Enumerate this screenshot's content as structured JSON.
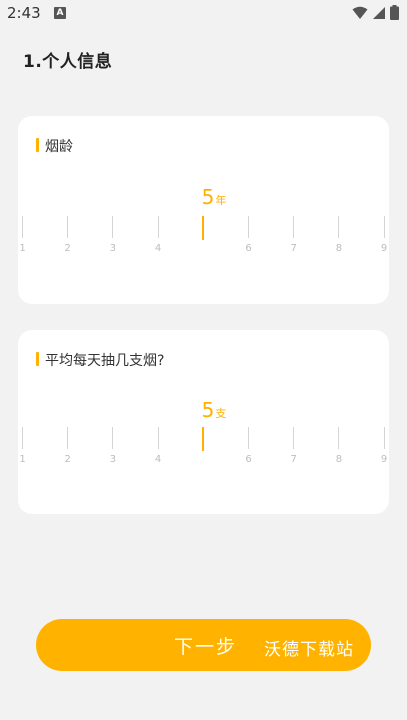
{
  "statusbar": {
    "time": "2:43",
    "a_badge": "A"
  },
  "page": {
    "title": "1.个人信息"
  },
  "cards": [
    {
      "label": "烟龄",
      "value": "5",
      "unit": "年",
      "ticks": [
        "1",
        "2",
        "3",
        "4",
        "5",
        "6",
        "7",
        "8",
        "9"
      ],
      "selected_tick": "5"
    },
    {
      "label": "平均每天抽几支烟?",
      "value": "5",
      "unit": "支",
      "ticks": [
        "1",
        "2",
        "3",
        "4",
        "5",
        "6",
        "7",
        "8",
        "9"
      ],
      "selected_tick": "5"
    }
  ],
  "next_button": {
    "label": "下一步"
  },
  "watermark": {
    "text": "沃德下载站"
  },
  "colors": {
    "accent": "#ffb300",
    "card": "#ffffff",
    "background": "#f2f2f2"
  }
}
